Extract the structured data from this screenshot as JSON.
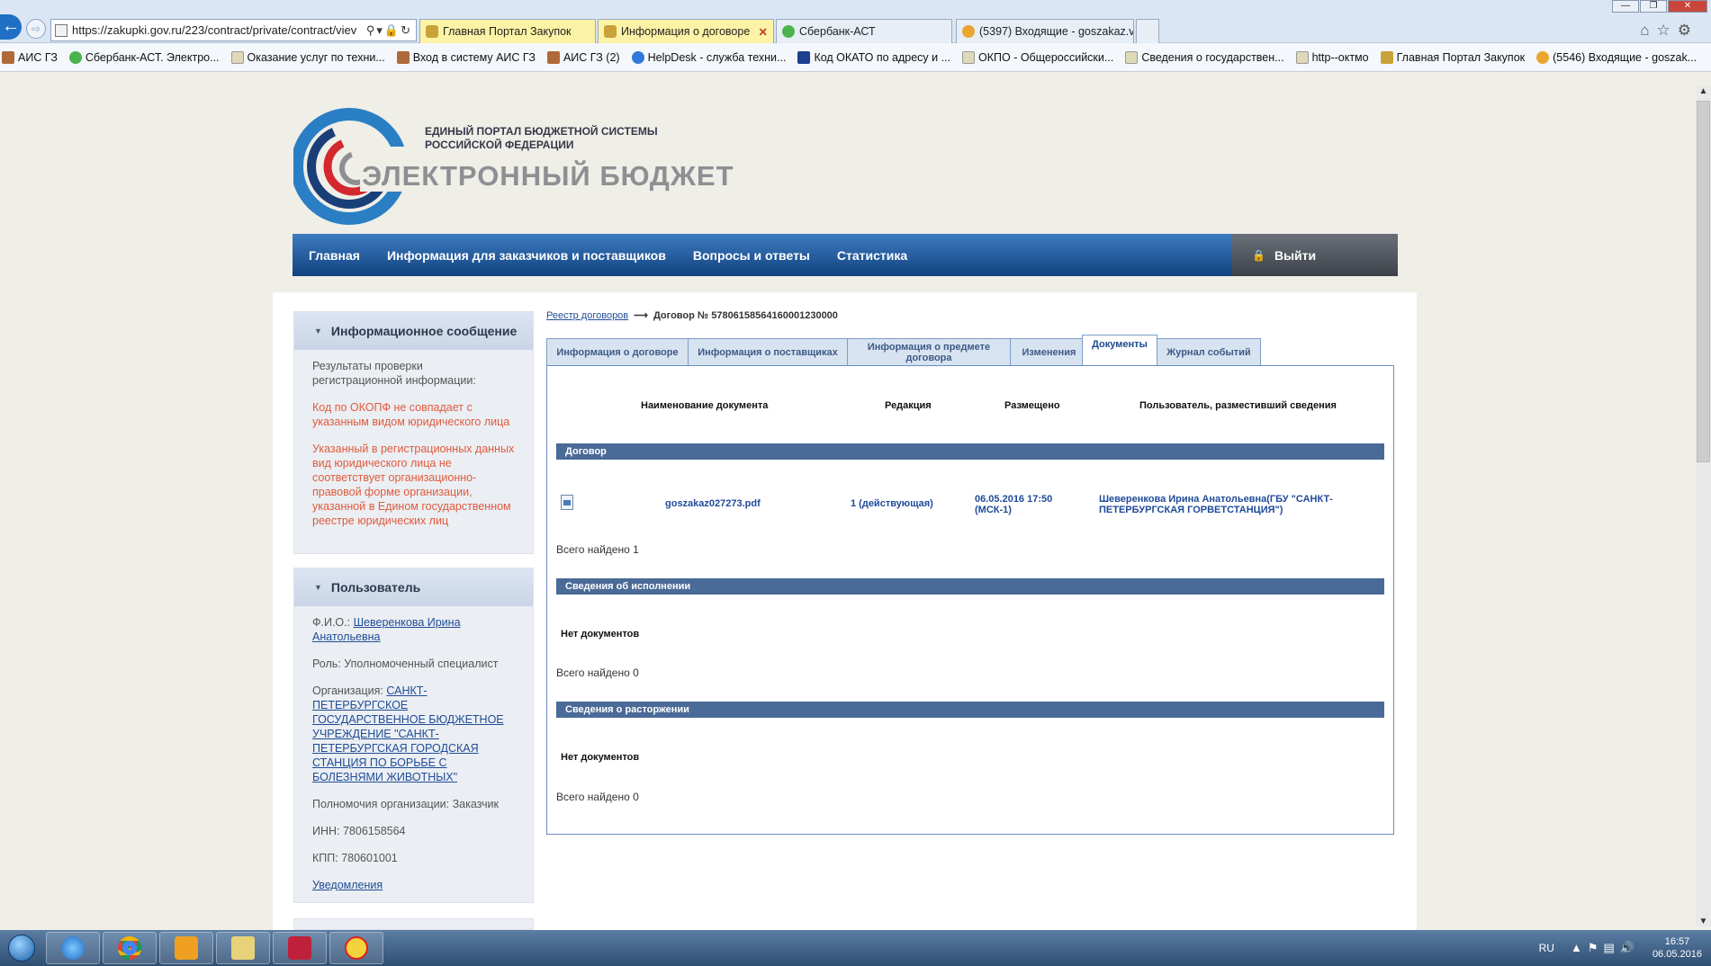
{
  "browser": {
    "url": "https://zakupki.gov.ru/223/contract/private/contract/viev",
    "tabs": [
      {
        "label": "Главная Портал Закупок",
        "active": false
      },
      {
        "label": "Информация о договоре",
        "active": true
      },
      {
        "label": "Сбербанк-АСТ",
        "active": false
      },
      {
        "label": "(5397) Входящие - goszakaz.v...",
        "active": false
      }
    ],
    "favorites": [
      "АИС ГЗ",
      "Сбербанк-АСТ. Электро...",
      "Оказание услуг по техни...",
      "Вход в систему  АИС ГЗ",
      "АИС ГЗ (2)",
      "HelpDesk - служба техни...",
      "Код ОКАТО по адресу и ...",
      "ОКПО - Общероссийски...",
      "Сведения о государствен...",
      "http--октмо",
      "Главная Портал Закупок",
      "(5546) Входящие - goszak..."
    ]
  },
  "header": {
    "subtitle_line1": "ЕДИНЫЙ ПОРТАЛ БЮДЖЕТНОЙ СИСТЕМЫ",
    "subtitle_line2": "РОССИЙСКОЙ ФЕДЕРАЦИИ",
    "title": "ЭЛЕКТРОННЫЙ БЮДЖЕТ"
  },
  "nav": {
    "items": [
      "Главная",
      "Информация для заказчиков и поставщиков",
      "Вопросы и ответы",
      "Статистика"
    ],
    "logout": "Выйти"
  },
  "info_panel": {
    "title": "Информационное сообщение",
    "intro": "Результаты проверки регистрационной информации:",
    "error1": "Код по ОКОПФ не совпадает с указанным видом юридического лица",
    "error2": "Указанный в регистрационных данных вид юридического лица не соответствует организационно-правовой форме организации, указанной в Едином государственном реестре юридических лиц"
  },
  "user_panel": {
    "title": "Пользователь",
    "fio_label": "Ф.И.О.:",
    "fio": "Шеверенкова Ирина Анатольевна",
    "role": "Роль: Уполномоченный специалист",
    "org_label": "Организация:",
    "org": "САНКТ-ПЕТЕРБУРГСКОЕ ГОСУДАРСТВЕННОЕ БЮДЖЕТНОЕ УЧРЕЖДЕНИЕ \"САНКТ-ПЕТЕРБУРГСКАЯ ГОРОДСКАЯ СТАНЦИЯ ПО БОРЬБЕ С БОЛЕЗНЯМИ ЖИВОТНЫХ\"",
    "powers": "Полномочия организации: Заказчик",
    "inn": "ИНН: 7806158564",
    "kpp": "КПП: 780601001",
    "notifications": "Уведомления"
  },
  "breadcrumb": {
    "registry": "Реестр договоров",
    "current": "Договор № 57806158564160001230000"
  },
  "doc_tabs": [
    "Информация о договоре",
    "Информация о поставщиках",
    "Информация о предмете договора",
    "Изменения",
    "Документы",
    "Журнал событий"
  ],
  "documents": {
    "columns": [
      "Наименование документа",
      "Редакция",
      "Размещено",
      "Пользователь, разместивший сведения"
    ],
    "sections": [
      {
        "title": "Договор",
        "rows": [
          {
            "file": "goszakaz027273.pdf",
            "revision": "1 (действующая)",
            "posted_line1": "06.05.2016 17:50",
            "posted_line2": "(МСК-1)",
            "user_line1": "Шеверенкова Ирина Анатольевна(ГБУ \"САНКТ-",
            "user_line2": "ПЕТЕРБУРГСКАЯ ГОРВЕТСТАНЦИЯ\")"
          }
        ],
        "found": "Всего найдено 1"
      },
      {
        "title": "Сведения об исполнении",
        "empty": "Нет документов",
        "found": "Всего найдено 0"
      },
      {
        "title": "Сведения о расторжении",
        "empty": "Нет документов",
        "found": "Всего найдено 0"
      }
    ]
  },
  "taskbar": {
    "lang": "RU",
    "time": "16:57",
    "date": "06.05.2016"
  }
}
